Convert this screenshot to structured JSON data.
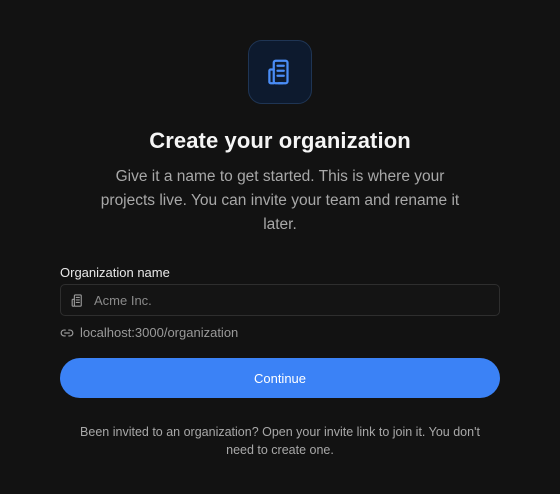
{
  "header": {
    "logo_icon": "building-icon",
    "title": "Create your organization",
    "subtitle": "Give it a name to get started. This is where your projects live. You can invite your team and rename it later."
  },
  "form": {
    "name_label": "Organization name",
    "name_placeholder": "Acme Inc.",
    "name_value": "",
    "name_icon": "building-icon",
    "url_icon": "link-icon",
    "url_preview": "localhost:3000/organization",
    "submit_label": "Continue"
  },
  "footer": {
    "note": "Been invited to an organization? Open your invite link to join it. You don't need to create one."
  },
  "colors": {
    "background": "#121212",
    "accent": "#3b82f6",
    "logo_tile": "#0d1a2e"
  }
}
